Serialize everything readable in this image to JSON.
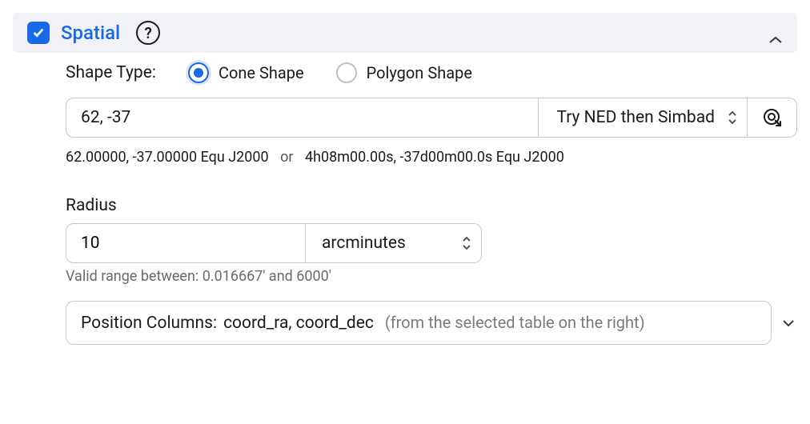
{
  "panel": {
    "title": "Spatial",
    "checked": true,
    "expanded": true
  },
  "shape": {
    "label": "Shape Type:",
    "cone": "Cone Shape",
    "polygon": "Polygon Shape",
    "selected": "cone"
  },
  "coords": {
    "value": "62, -37",
    "resolver": "Try NED then Simbad",
    "parsed_decimal": "62.00000, -37.00000  Equ J2000",
    "or": "or",
    "parsed_hms": "4h08m00.00s, -37d00m00.0s  Equ J2000"
  },
  "radius": {
    "label": "Radius",
    "value": "10",
    "unit": "arcminutes",
    "hint": "Valid range between: 0.016667' and 6000'"
  },
  "position": {
    "label": "Position Columns:",
    "value": "coord_ra, coord_dec",
    "note": "(from the selected table on the right)"
  }
}
